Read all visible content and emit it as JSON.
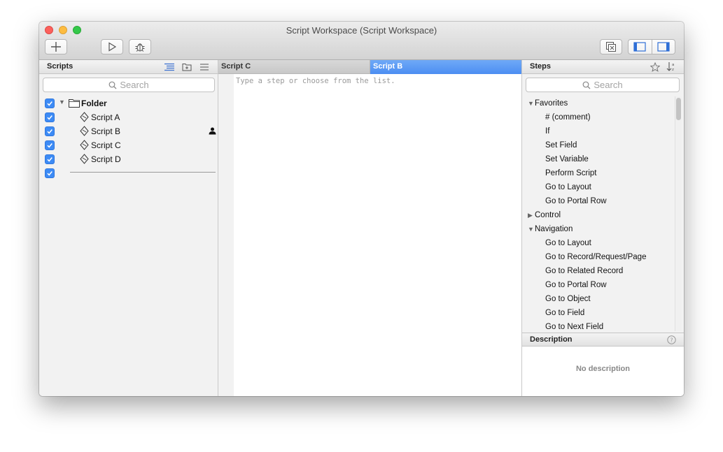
{
  "window": {
    "title": "Script Workspace (Script Workspace)"
  },
  "toolbar": {
    "new_icon": "plus-icon",
    "run_icon": "play-icon",
    "debug_icon": "bug-icon",
    "manage_icon": "manage-windows-icon",
    "left_pane_icon": "sidebar-left-icon",
    "right_pane_icon": "sidebar-right-icon"
  },
  "scripts": {
    "header": "Scripts",
    "search_placeholder": "Search",
    "folder": "Folder",
    "items": [
      "Script A",
      "Script B",
      "Script C",
      "Script D"
    ]
  },
  "editor": {
    "tabs": [
      "Script C",
      "Script B"
    ],
    "active_tab": "Script B",
    "placeholder": "Type a step or choose from the list."
  },
  "steps": {
    "header": "Steps",
    "search_placeholder": "Search",
    "favorites_label": "Favorites",
    "favorites": [
      "# (comment)",
      "If",
      "Set Field",
      "Set Variable",
      "Perform Script",
      "Go to Layout",
      "Go to Portal Row"
    ],
    "control_label": "Control",
    "navigation_label": "Navigation",
    "navigation": [
      "Go to Layout",
      "Go to Record/Request/Page",
      "Go to Related Record",
      "Go to Portal Row",
      "Go to Object",
      "Go to Field",
      "Go to Next Field"
    ]
  },
  "description": {
    "header": "Description",
    "empty_text": "No description"
  },
  "colors": {
    "accent": "#3d8bf5",
    "active_tab": "#5a98f4"
  }
}
